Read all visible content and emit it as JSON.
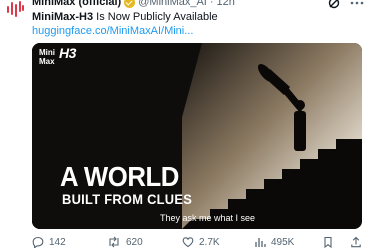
{
  "tweet": {
    "author_name": "MiniMax (official)",
    "handle": "@MiniMax_AI",
    "separator": "·",
    "time": "12h",
    "text_bold": "MiniMax-H3",
    "text_rest": " Is Now Publicly Available",
    "link": "huggingface.co/MiniMaxAI/Mini..."
  },
  "media": {
    "brand_top": "Mini",
    "brand_bottom": "Max",
    "brand_model": "H3",
    "headline": "A WORLD",
    "subhead": "BUILT FROM CLUES",
    "caption": "They ask me what I see"
  },
  "actions": {
    "replies": "142",
    "reposts": "620",
    "likes": "2.7K",
    "views": "495K"
  },
  "icons": {
    "verified": "verified-badge-icon",
    "grok": "grok-icon",
    "more": "more-icon",
    "reply": "reply-icon",
    "repost": "repost-icon",
    "like": "heart-icon",
    "views": "views-icon",
    "bookmark": "bookmark-icon",
    "share": "share-icon"
  },
  "colors": {
    "link": "#1d9bf0",
    "secondary_text": "#536471",
    "verified_gold": "#e6b820",
    "avatar_red": "#e0384b"
  }
}
